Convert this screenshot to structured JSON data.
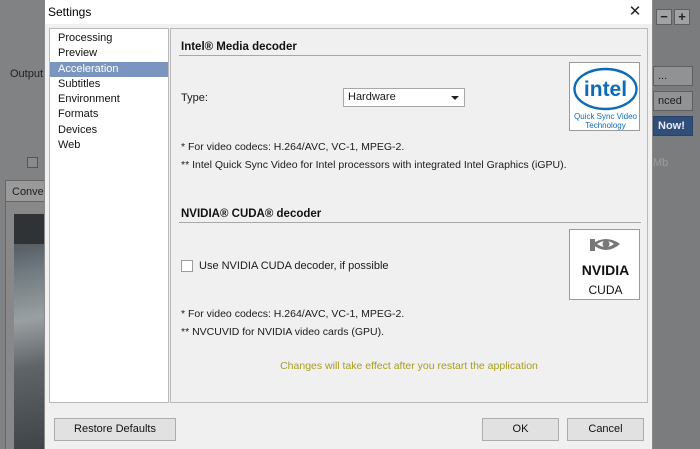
{
  "background": {
    "output_label": "Output",
    "tab_label": "Conve",
    "buttons": [
      "...",
      "nced",
      "Now!"
    ],
    "size_unit": "Mb",
    "mini_buttons": [
      "−",
      "+"
    ]
  },
  "dialog": {
    "title": "Settings",
    "nav": [
      {
        "label": "Processing",
        "active": false
      },
      {
        "label": "Preview",
        "active": false
      },
      {
        "label": "Acceleration",
        "active": true
      },
      {
        "label": "Subtitles",
        "active": false
      },
      {
        "label": "Environment",
        "active": false
      },
      {
        "label": "Formats",
        "active": false
      },
      {
        "label": "Devices",
        "active": false
      },
      {
        "label": "Web",
        "active": false
      }
    ],
    "intel": {
      "title": "Intel® Media decoder",
      "type_label": "Type:",
      "type_value": "Hardware",
      "note1": "*  For video codecs: H.264/AVC, VC-1, MPEG-2.",
      "note2": "** Intel Quick Sync Video for Intel processors with integrated Intel Graphics (iGPU).",
      "logo_word": "intel",
      "logo_line1": "Quick Sync Video",
      "logo_line2": "Technology"
    },
    "nvidia": {
      "title": "NVIDIA® CUDA® decoder",
      "checkbox_label": "Use NVIDIA CUDA decoder, if possible",
      "checked": false,
      "note1": "*  For video codecs: H.264/AVC, VC-1, MPEG-2.",
      "note2": "** NVCUVID for NVIDIA video cards (GPU).",
      "logo_word": "NVIDIA",
      "logo_sub": "CUDA"
    },
    "restart_note": "Changes will take effect after you restart the application",
    "buttons": {
      "restore": "Restore Defaults",
      "ok": "OK",
      "cancel": "Cancel"
    }
  },
  "colors": {
    "nav_active": "#7a96c0",
    "restart_note": "#a79d21",
    "intel_blue": "#0f6bb5"
  }
}
